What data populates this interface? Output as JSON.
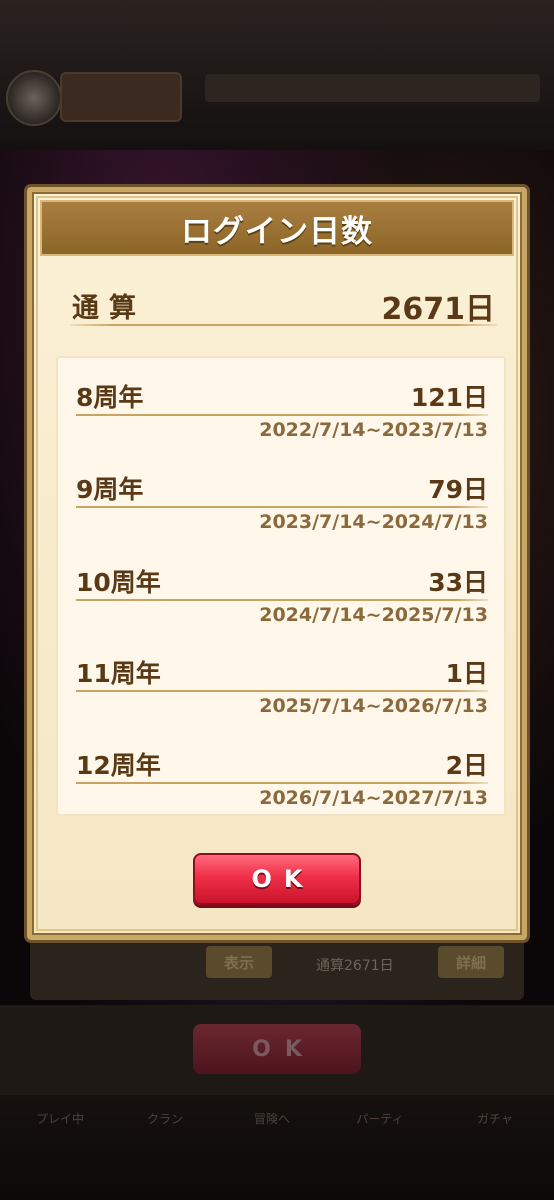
{
  "dialog": {
    "title": "ログイン日数",
    "total": {
      "label": "通算",
      "value": "2671日"
    },
    "years": [
      {
        "label": "8周年",
        "days": "121日",
        "range": "2022/7/14~2023/7/13"
      },
      {
        "label": "9周年",
        "days": "79日",
        "range": "2023/7/14~2024/7/13"
      },
      {
        "label": "10周年",
        "days": "33日",
        "range": "2024/7/14~2025/7/13"
      },
      {
        "label": "11周年",
        "days": "1日",
        "range": "2025/7/14~2026/7/13"
      },
      {
        "label": "12周年",
        "days": "2日",
        "range": "2026/7/14~2027/7/13"
      }
    ],
    "ok_label": "OK"
  },
  "background": {
    "show_button": "表示",
    "detail_button": "詳細",
    "login_total": "通算2671日",
    "ok_label": "OK",
    "nav": [
      "プレイ中",
      "クラン",
      "冒険へ",
      "パーティ",
      "ガチャ"
    ]
  },
  "colors": {
    "accent_red": "#ef2f48",
    "header_brown": "#a97f40",
    "text_brown": "#5a3a16",
    "panel_cream": "#fbf1d6"
  }
}
